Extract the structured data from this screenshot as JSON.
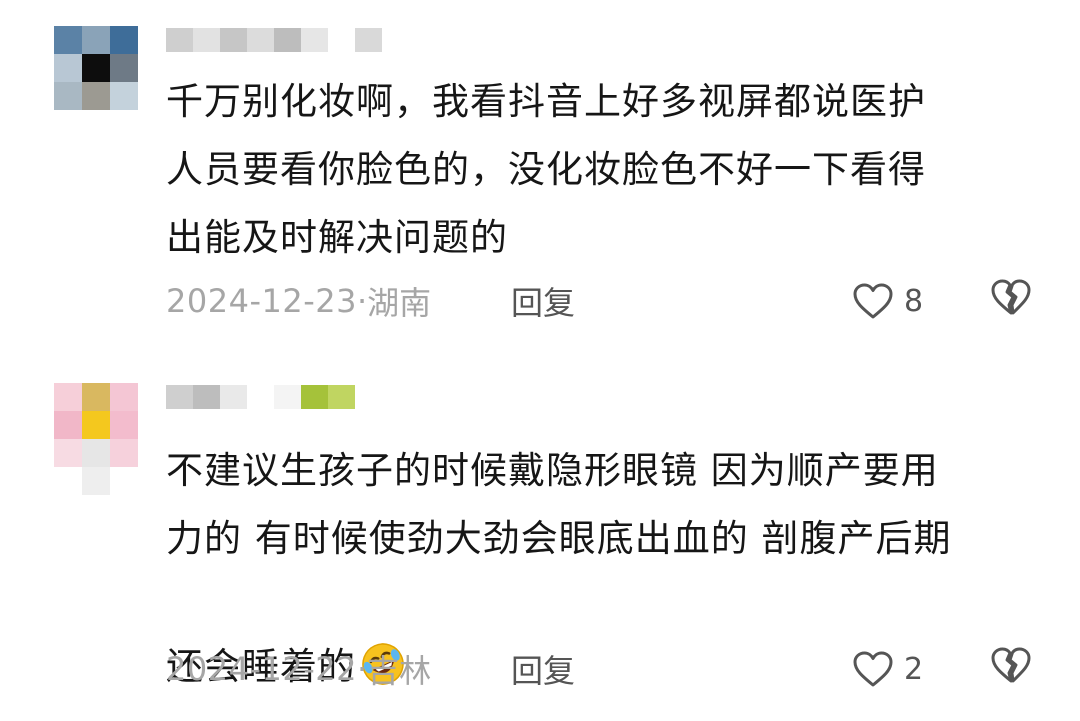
{
  "comments": [
    {
      "text": "千万别化妆啊，我看抖音上好多视屏都说医护人员要看你脸色的，没化妆脸色不好一下看得出能及时解决问题的",
      "lines": [
        "千万别化妆啊，我看抖音上好多视屏都说医护",
        "人员要看你脸色的，没化妆脸色不好一下看得",
        "出能及时解决问题的"
      ],
      "date": "2024-12-23",
      "sep": "·",
      "location": "湖南",
      "reply_label": "回复",
      "like_count": "8",
      "avatar_colors": [
        "#5b82a6",
        "#8aa3b8",
        "#3e6d99",
        "#b8c7d4",
        "#0d0d0d",
        "#6e7a86",
        "#a9b8c3",
        "#9c9a92",
        "#c4d2dc"
      ],
      "username_colors": [
        "#cfcfcf",
        "#e2e2e2",
        "#c6c6c6",
        "#dcdcdc",
        "#bdbdbd",
        "#e6e6e6",
        "#ffffff",
        "#d9d9d9"
      ]
    },
    {
      "text": "不建议生孩子的时候戴隐形眼镜 因为顺产要用力的 有时候使劲大劲会眼底出血的 剖腹产后期还会睡着的",
      "lines": [
        "不建议生孩子的时候戴隐形眼镜 因为顺产要用",
        "力的 有时候使劲大劲会眼底出血的 剖腹产后期",
        "还会睡着的"
      ],
      "date": "2024-12-22",
      "sep": "·",
      "location": "吉林",
      "reply_label": "回复",
      "like_count": "2",
      "emoji": "rolling-on-floor-laughing-emoji",
      "avatar_colors": [
        "#f6cfd9",
        "#d9b860",
        "#f4c6d4",
        "#f1b7c8",
        "#f4c81e",
        "#f3bccd",
        "#f7dbe3",
        "#e6e6e6",
        "#f6d1dc",
        "#ffffff",
        "#eeeeee",
        "#ffffff"
      ],
      "username_colors": [
        "#cfcfcf",
        "#bdbdbd",
        "#e9e9e9",
        "#ffffff",
        "#f4f4f4",
        "#a5c23a",
        "#c0d561"
      ]
    }
  ]
}
